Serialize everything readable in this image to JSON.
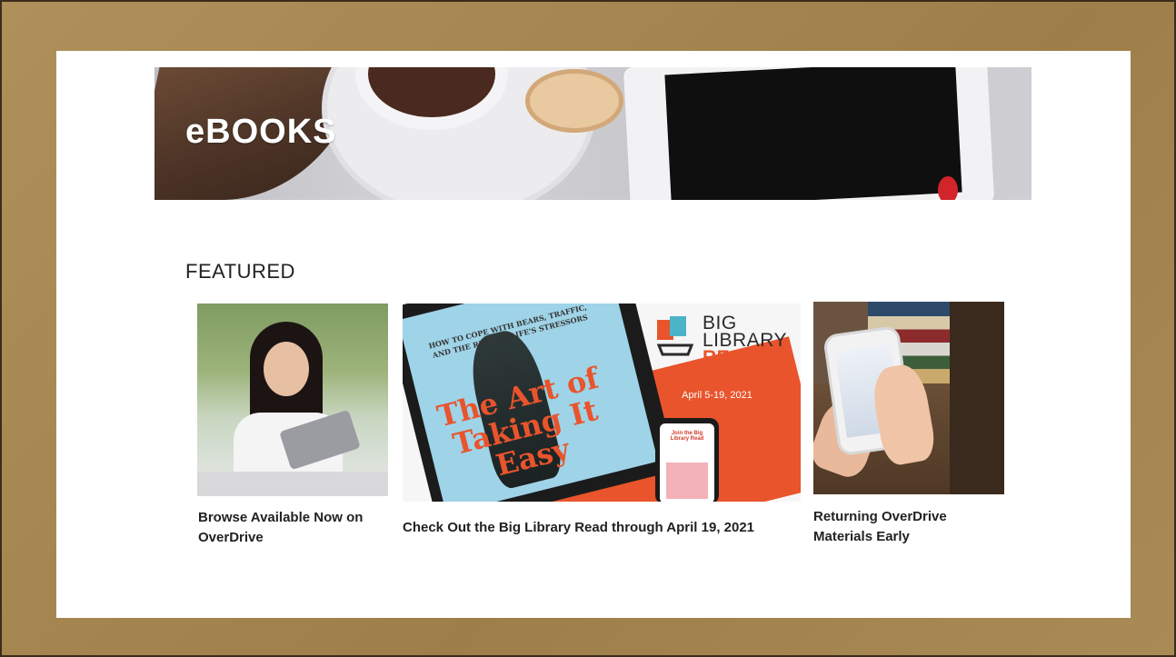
{
  "banner": {
    "title": "eBOOKS"
  },
  "featured": {
    "heading": "FEATURED",
    "cards": [
      {
        "label": "Browse Available Now on OverDrive"
      },
      {
        "label": "Check Out the Big Library Read through April 19, 2021",
        "art": {
          "book_subtitle": "HOW TO COPE WITH BEARS, TRAFFIC, AND THE REST OF LIFE'S STRESSORS",
          "book_title": "The Art of Taking It Easy",
          "logo_line1": "BIG",
          "logo_line2": "LIBRARY",
          "logo_line3": "READ",
          "date": "April 5-19, 2021",
          "phone_text": "Join the Big Library Read"
        }
      },
      {
        "label": "Returning OverDrive Materials Early"
      }
    ]
  },
  "colors": {
    "accent": "#e9542c",
    "frame": "#a98a52",
    "sky": "#9fd3e7"
  }
}
